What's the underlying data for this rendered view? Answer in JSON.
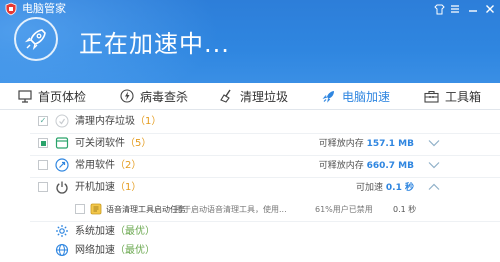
{
  "app": {
    "title": "电脑管家"
  },
  "status": {
    "text": "正在加速中..."
  },
  "tabs": [
    {
      "label": "首页体检",
      "icon": "monitor-icon",
      "active": false
    },
    {
      "label": "病毒查杀",
      "icon": "lightning-icon",
      "active": false
    },
    {
      "label": "清理垃圾",
      "icon": "broom-icon",
      "active": false
    },
    {
      "label": "电脑加速",
      "icon": "rocket-icon",
      "active": true
    },
    {
      "label": "工具箱",
      "icon": "toolbox-icon",
      "active": false
    }
  ],
  "rows": [
    {
      "label": "清理内存垃圾",
      "count": "（1）"
    },
    {
      "label": "可关闭软件",
      "count": "（5）",
      "right_label": "可释放内存",
      "right_value": "157.1 MB"
    },
    {
      "label": "常用软件",
      "count": "（2）",
      "right_label": "可释放内存",
      "right_value": "660.7 MB"
    },
    {
      "label": "开机加速",
      "count": "（1）",
      "right_label": "可加速",
      "right_value": "0.1 秒"
    }
  ],
  "sub_row": {
    "name": "语音清理工具启动任务",
    "desc": "用于启动语音清理工具，使用...",
    "pct": "61%用户已禁用",
    "time": "0.1 秒"
  },
  "opt_rows": [
    {
      "label": "系统加速",
      "tag": "（最优）"
    },
    {
      "label": "网络加速",
      "tag": "（最优）"
    }
  ],
  "colors": {
    "header": "#2f86e0",
    "accent": "#2f86e0",
    "count": "#e49b1d",
    "optimal": "#6aa84f"
  }
}
